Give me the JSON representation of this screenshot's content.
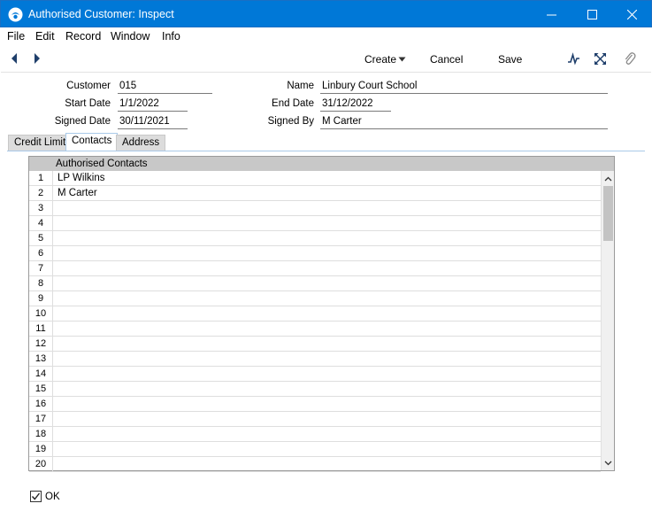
{
  "window": {
    "title": "Authorised Customer: Inspect"
  },
  "menu": {
    "items": [
      "File",
      "Edit",
      "Record",
      "Window",
      "Info"
    ]
  },
  "toolbar": {
    "create_label": "Create",
    "cancel_label": "Cancel",
    "save_label": "Save"
  },
  "form": {
    "customer_label": "Customer",
    "customer_value": "015",
    "start_date_label": "Start Date",
    "start_date_value": "1/1/2022",
    "signed_date_label": "Signed Date",
    "signed_date_value": "30/11/2021",
    "name_label": "Name",
    "name_value": "Linbury Court School",
    "end_date_label": "End Date",
    "end_date_value": "31/12/2022",
    "signed_by_label": "Signed By",
    "signed_by_value": "M Carter"
  },
  "tabs": {
    "items": [
      "Credit Limit",
      "Contacts",
      "Address"
    ],
    "active": "Contacts"
  },
  "grid": {
    "header": "Authorised Contacts",
    "rows": [
      {
        "num": "1",
        "value": "LP Wilkins"
      },
      {
        "num": "2",
        "value": "M Carter"
      },
      {
        "num": "3",
        "value": ""
      },
      {
        "num": "4",
        "value": ""
      },
      {
        "num": "5",
        "value": ""
      },
      {
        "num": "6",
        "value": ""
      },
      {
        "num": "7",
        "value": ""
      },
      {
        "num": "8",
        "value": ""
      },
      {
        "num": "9",
        "value": ""
      },
      {
        "num": "10",
        "value": ""
      },
      {
        "num": "11",
        "value": ""
      },
      {
        "num": "12",
        "value": ""
      },
      {
        "num": "13",
        "value": ""
      },
      {
        "num": "14",
        "value": ""
      },
      {
        "num": "15",
        "value": ""
      },
      {
        "num": "16",
        "value": ""
      },
      {
        "num": "17",
        "value": ""
      },
      {
        "num": "18",
        "value": ""
      },
      {
        "num": "19",
        "value": ""
      },
      {
        "num": "20",
        "value": ""
      }
    ]
  },
  "ok": {
    "label": "OK",
    "checked": true
  }
}
